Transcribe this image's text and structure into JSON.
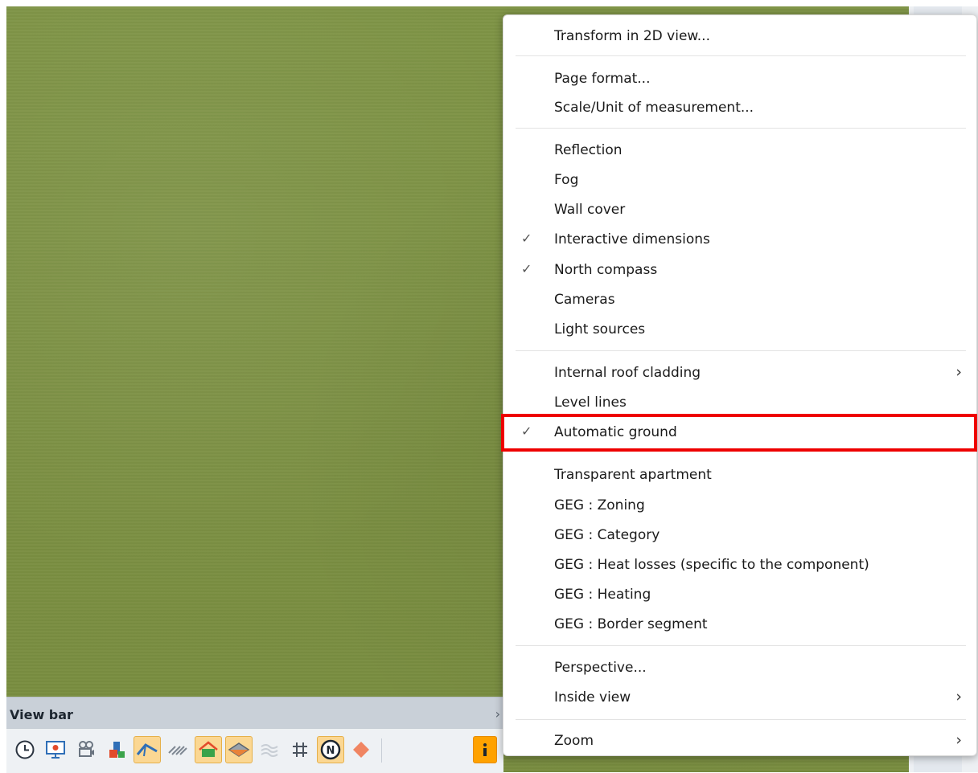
{
  "viewbar": {
    "title": "View bar",
    "collapse_glyph": "›",
    "tools": [
      {
        "name": "clock-icon"
      },
      {
        "name": "presentation-icon"
      },
      {
        "name": "camera-icon"
      },
      {
        "name": "layers-icon"
      },
      {
        "name": "roof-view-icon",
        "state": "active"
      },
      {
        "name": "hatch-icon"
      },
      {
        "name": "house-view-icon",
        "state": "active"
      },
      {
        "name": "ground-icon",
        "state": "active"
      },
      {
        "name": "wave-icon"
      },
      {
        "name": "grid-icon"
      },
      {
        "name": "north-compass-icon",
        "state": "active"
      },
      {
        "name": "diamond-icon"
      },
      {
        "name": "info-icon",
        "state": "hot"
      }
    ]
  },
  "menu": {
    "items": [
      {
        "label": "Transform in 2D view...",
        "checked": false,
        "submenu": false
      },
      {
        "label": "Page format...",
        "checked": false,
        "submenu": false
      },
      {
        "label": "Scale/Unit of measurement...",
        "checked": false,
        "submenu": false
      },
      {
        "label": "Reflection",
        "checked": false,
        "submenu": false
      },
      {
        "label": "Fog",
        "checked": false,
        "submenu": false
      },
      {
        "label": "Wall cover",
        "checked": false,
        "submenu": false
      },
      {
        "label": "Interactive dimensions",
        "checked": true,
        "submenu": false
      },
      {
        "label": "North compass",
        "checked": true,
        "submenu": false
      },
      {
        "label": "Cameras",
        "checked": false,
        "submenu": false
      },
      {
        "label": "Light sources",
        "checked": false,
        "submenu": false
      },
      {
        "label": "Internal roof cladding",
        "checked": false,
        "submenu": true
      },
      {
        "label": "Level lines",
        "checked": false,
        "submenu": false
      },
      {
        "label": "Automatic ground",
        "checked": true,
        "submenu": false,
        "highlighted": true
      },
      {
        "label": "Transparent apartment",
        "checked": false,
        "submenu": false
      },
      {
        "label": "GEG : Zoning",
        "checked": false,
        "submenu": false
      },
      {
        "label": "GEG : Category",
        "checked": false,
        "submenu": false
      },
      {
        "label": "GEG : Heat losses (specific to the component)",
        "checked": false,
        "submenu": false
      },
      {
        "label": "GEG : Heating",
        "checked": false,
        "submenu": false
      },
      {
        "label": "GEG : Border segment",
        "checked": false,
        "submenu": false
      },
      {
        "label": "Perspective...",
        "checked": false,
        "submenu": false
      },
      {
        "label": "Inside view",
        "checked": false,
        "submenu": true
      },
      {
        "label": "Zoom",
        "checked": false,
        "submenu": true
      }
    ],
    "check_glyph": "✓",
    "submenu_glyph": "›"
  },
  "colors": {
    "highlight_border": "#ee0000",
    "ground": "#7d9144",
    "active_tool": "#fbd793",
    "hot_tool": "#ffa200"
  }
}
